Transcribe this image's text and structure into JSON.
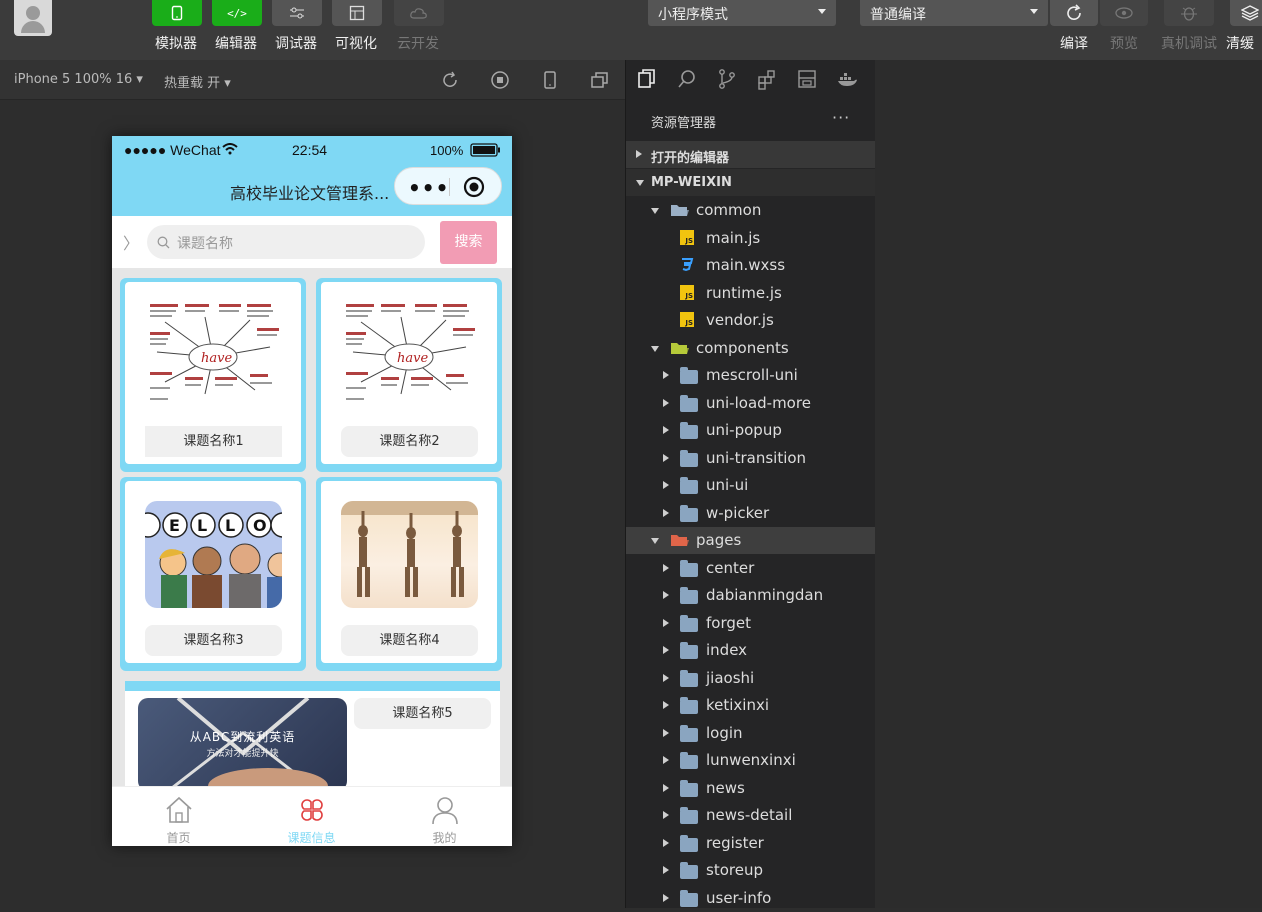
{
  "toolbar": {
    "buttons": [
      {
        "label": "模拟器",
        "icon": "phone-icon"
      },
      {
        "label": "编辑器",
        "icon": "code-icon"
      },
      {
        "label": "调试器",
        "icon": "sliders-icon"
      },
      {
        "label": "可视化",
        "icon": "layout-icon"
      },
      {
        "label": "云开发",
        "icon": "cloud-icon"
      }
    ],
    "mode_select": "小程序模式",
    "compile_select": "普通编译",
    "right_buttons": [
      {
        "label": "编译",
        "icon": "refresh-icon"
      },
      {
        "label": "预览",
        "icon": "eye-icon"
      },
      {
        "label": "真机调试",
        "icon": "bug-icon"
      },
      {
        "label": "清缓",
        "icon": "layers-icon"
      }
    ]
  },
  "simbar": {
    "device": "iPhone 5 100% 16 ▾",
    "hotreload": "热重载 开 ▾"
  },
  "phone": {
    "status": {
      "carrier": "●●●●● WeChat",
      "time": "22:54",
      "battery": "100%"
    },
    "nav_title": "高校毕业论文管理系...",
    "search_placeholder": "课题名称",
    "search_button": "搜索",
    "cards": [
      {
        "caption": "课题名称1"
      },
      {
        "caption": "课题名称2"
      },
      {
        "caption": "课题名称3"
      },
      {
        "caption": "课题名称4"
      },
      {
        "caption": "课题名称5",
        "banner_line1": "从ABC到流利英语",
        "banner_line2": "方法对才能提升快"
      }
    ],
    "tabs": [
      {
        "label": "首页",
        "active": false
      },
      {
        "label": "课题信息",
        "active": true
      },
      {
        "label": "我的",
        "active": false
      }
    ],
    "colors": {
      "accent": "#7fd8f4",
      "search_button": "#f29cb4",
      "tab_active": "#7fd8f4"
    }
  },
  "explorer": {
    "title": "资源管理器",
    "more": "···",
    "open_editors": "打开的编辑器",
    "project": "MP-WEIXIN",
    "tree": [
      {
        "name": "common",
        "type": "folder-open",
        "depth": 1
      },
      {
        "name": "main.js",
        "type": "js",
        "depth": 2
      },
      {
        "name": "main.wxss",
        "type": "css",
        "depth": 2
      },
      {
        "name": "runtime.js",
        "type": "js",
        "depth": 2
      },
      {
        "name": "vendor.js",
        "type": "js",
        "depth": 2
      },
      {
        "name": "components",
        "type": "folder-open",
        "depth": 1
      },
      {
        "name": "mescroll-uni",
        "type": "folder",
        "depth": 2
      },
      {
        "name": "uni-load-more",
        "type": "folder",
        "depth": 2
      },
      {
        "name": "uni-popup",
        "type": "folder",
        "depth": 2
      },
      {
        "name": "uni-transition",
        "type": "folder",
        "depth": 2
      },
      {
        "name": "uni-ui",
        "type": "folder",
        "depth": 2
      },
      {
        "name": "w-picker",
        "type": "folder",
        "depth": 2
      },
      {
        "name": "pages",
        "type": "folder-open",
        "depth": 1,
        "selected": true
      },
      {
        "name": "center",
        "type": "folder",
        "depth": 2
      },
      {
        "name": "dabianmingdan",
        "type": "folder",
        "depth": 2
      },
      {
        "name": "forget",
        "type": "folder",
        "depth": 2
      },
      {
        "name": "index",
        "type": "folder",
        "depth": 2
      },
      {
        "name": "jiaoshi",
        "type": "folder",
        "depth": 2
      },
      {
        "name": "ketixinxi",
        "type": "folder",
        "depth": 2
      },
      {
        "name": "login",
        "type": "folder",
        "depth": 2
      },
      {
        "name": "lunwenxinxi",
        "type": "folder",
        "depth": 2
      },
      {
        "name": "news",
        "type": "folder",
        "depth": 2
      },
      {
        "name": "news-detail",
        "type": "folder",
        "depth": 2
      },
      {
        "name": "register",
        "type": "folder",
        "depth": 2
      },
      {
        "name": "storeup",
        "type": "folder",
        "depth": 2
      },
      {
        "name": "user-info",
        "type": "folder",
        "depth": 2
      }
    ]
  }
}
